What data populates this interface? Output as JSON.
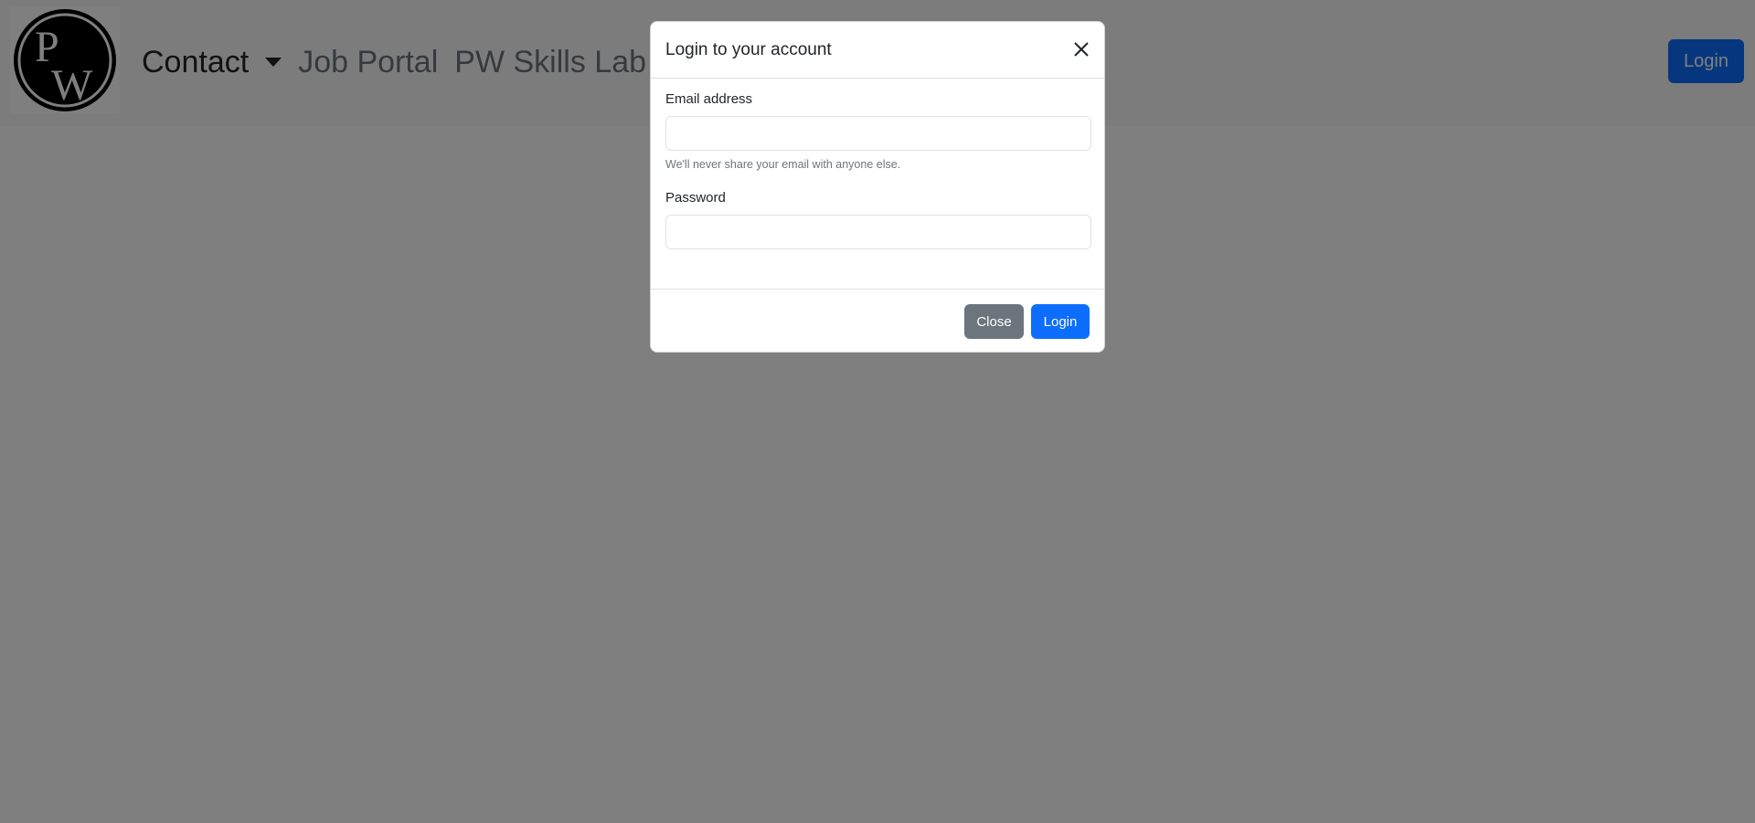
{
  "navbar": {
    "logo_text": "PW",
    "links": [
      {
        "label": "Contact",
        "has_dropdown": true
      },
      {
        "label": "Job Portal",
        "has_dropdown": false
      },
      {
        "label": "PW Skills Lab",
        "has_dropdown": false
      }
    ],
    "login_label": "Login"
  },
  "modal": {
    "title": "Login to your account",
    "email_label": "Email address",
    "email_value": "",
    "email_help": "We'll never share your email with anyone else.",
    "password_label": "Password",
    "password_value": "",
    "close_label": "Close",
    "login_label": "Login"
  },
  "colors": {
    "primary": "#0d6efd",
    "secondary": "#6c757d",
    "backdrop": "rgba(0,0,0,0.5)"
  },
  "icons": {
    "modal_close": "close-icon",
    "dropdown": "caret-down-icon"
  }
}
